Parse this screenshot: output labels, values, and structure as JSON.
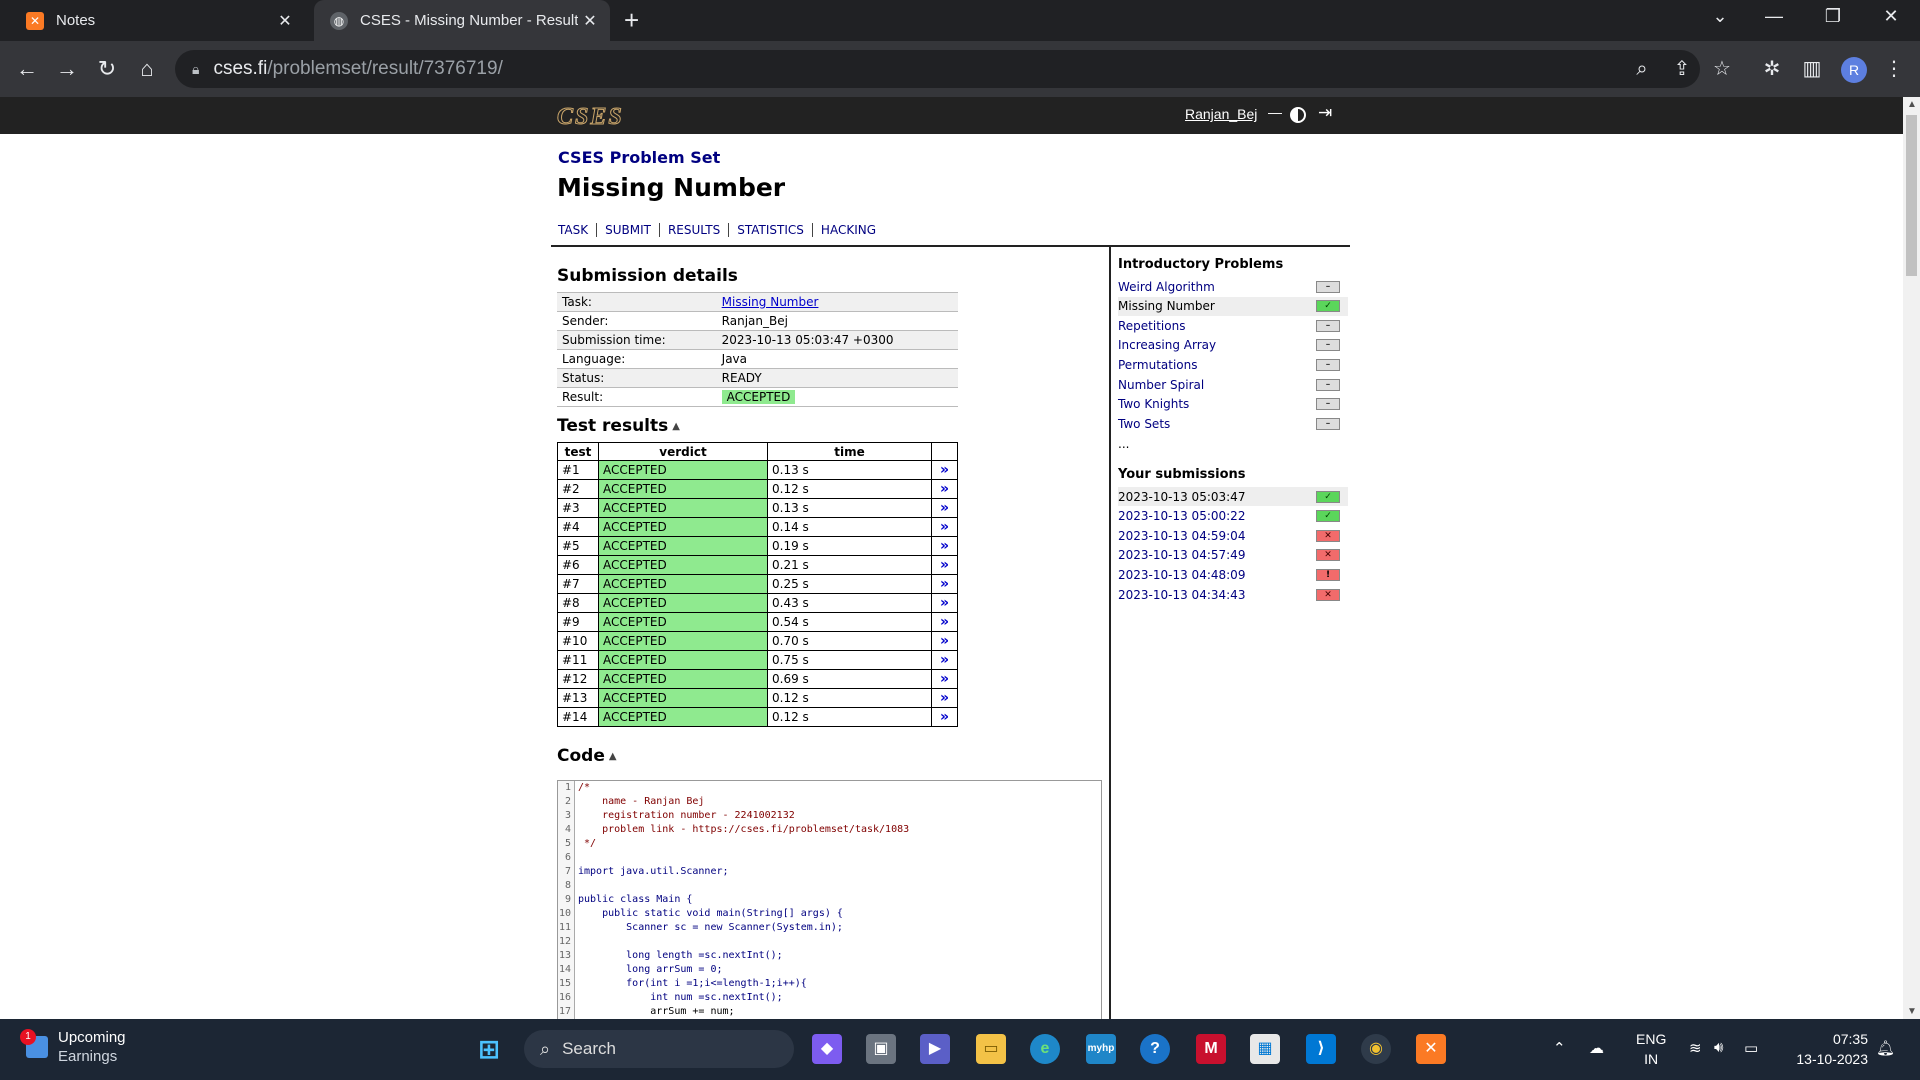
{
  "browser": {
    "tabs": [
      {
        "title": "Notes",
        "icon": "xampp-icon"
      },
      {
        "title": "CSES - Missing Number - Result",
        "icon": "globe-icon"
      }
    ],
    "url_host": "cses.fi",
    "url_path": "/problemset/result/7376719/"
  },
  "site": {
    "logo": "CSES",
    "username": "Ranjan_Bej",
    "dash": "—"
  },
  "page": {
    "breadcrumb": "CSES Problem Set",
    "title": "Missing Number",
    "nav": [
      "TASK",
      "SUBMIT",
      "RESULTS",
      "STATISTICS",
      "HACKING"
    ]
  },
  "details": {
    "heading": "Submission details",
    "rows": [
      {
        "label": "Task:",
        "value": "Missing Number"
      },
      {
        "label": "Sender:",
        "value": "Ranjan_Bej"
      },
      {
        "label": "Submission time:",
        "value": "2023-10-13 05:03:47 +0300"
      },
      {
        "label": "Language:",
        "value": "Java"
      },
      {
        "label": "Status:",
        "value": "READY"
      },
      {
        "label": "Result:",
        "value": "ACCEPTED"
      }
    ]
  },
  "tests": {
    "heading": "Test results",
    "headers": [
      "test",
      "verdict",
      "time"
    ],
    "link_glyph": "»",
    "rows": [
      {
        "id": "#1",
        "verdict": "ACCEPTED",
        "time": "0.13 s"
      },
      {
        "id": "#2",
        "verdict": "ACCEPTED",
        "time": "0.12 s"
      },
      {
        "id": "#3",
        "verdict": "ACCEPTED",
        "time": "0.13 s"
      },
      {
        "id": "#4",
        "verdict": "ACCEPTED",
        "time": "0.14 s"
      },
      {
        "id": "#5",
        "verdict": "ACCEPTED",
        "time": "0.19 s"
      },
      {
        "id": "#6",
        "verdict": "ACCEPTED",
        "time": "0.21 s"
      },
      {
        "id": "#7",
        "verdict": "ACCEPTED",
        "time": "0.25 s"
      },
      {
        "id": "#8",
        "verdict": "ACCEPTED",
        "time": "0.43 s"
      },
      {
        "id": "#9",
        "verdict": "ACCEPTED",
        "time": "0.54 s"
      },
      {
        "id": "#10",
        "verdict": "ACCEPTED",
        "time": "0.70 s"
      },
      {
        "id": "#11",
        "verdict": "ACCEPTED",
        "time": "0.75 s"
      },
      {
        "id": "#12",
        "verdict": "ACCEPTED",
        "time": "0.69 s"
      },
      {
        "id": "#13",
        "verdict": "ACCEPTED",
        "time": "0.12 s"
      },
      {
        "id": "#14",
        "verdict": "ACCEPTED",
        "time": "0.12 s"
      }
    ]
  },
  "code": {
    "heading": "Code",
    "lines": [
      "/*",
      "    name - Ranjan Bej",
      "    registration number - 2241002132",
      "    problem link - https://cses.fi/problemset/task/1083",
      " */",
      "",
      "import java.util.Scanner;",
      "",
      "public class Main {",
      "    public static void main(String[] args) {",
      "        Scanner sc = new Scanner(System.in);",
      "",
      "        long length =sc.nextInt();",
      "        long arrSum = 0;",
      "        for(int i =1;i<=length-1;i++){",
      "            int num =sc.nextInt();",
      "            arrSum += num;"
    ]
  },
  "sidebar": {
    "heading": "Introductory Problems",
    "problems": [
      {
        "name": "Weird Algorithm",
        "status": "none"
      },
      {
        "name": "Missing Number",
        "status": "ok",
        "current": true
      },
      {
        "name": "Repetitions",
        "status": "none"
      },
      {
        "name": "Increasing Array",
        "status": "none"
      },
      {
        "name": "Permutations",
        "status": "none"
      },
      {
        "name": "Number Spiral",
        "status": "none"
      },
      {
        "name": "Two Knights",
        "status": "none"
      },
      {
        "name": "Two Sets",
        "status": "none"
      }
    ],
    "more": "...",
    "subs_heading": "Your submissions",
    "submissions": [
      {
        "time": "2023-10-13 05:03:47",
        "status": "ok",
        "current": true
      },
      {
        "time": "2023-10-13 05:00:22",
        "status": "ok"
      },
      {
        "time": "2023-10-13 04:59:04",
        "status": "fail"
      },
      {
        "time": "2023-10-13 04:57:49",
        "status": "fail"
      },
      {
        "time": "2023-10-13 04:48:09",
        "status": "err"
      },
      {
        "time": "2023-10-13 04:34:43",
        "status": "fail"
      }
    ]
  },
  "taskbar": {
    "weather_title": "Upcoming",
    "weather_sub": "Earnings",
    "notif_count": "1",
    "search": "Search",
    "lang1": "ENG",
    "lang2": "IN",
    "time": "07:35",
    "date": "13-10-2023"
  },
  "colors": {
    "accepted": "#8fea8f",
    "link": "#000080",
    "header_bg": "#222222"
  }
}
